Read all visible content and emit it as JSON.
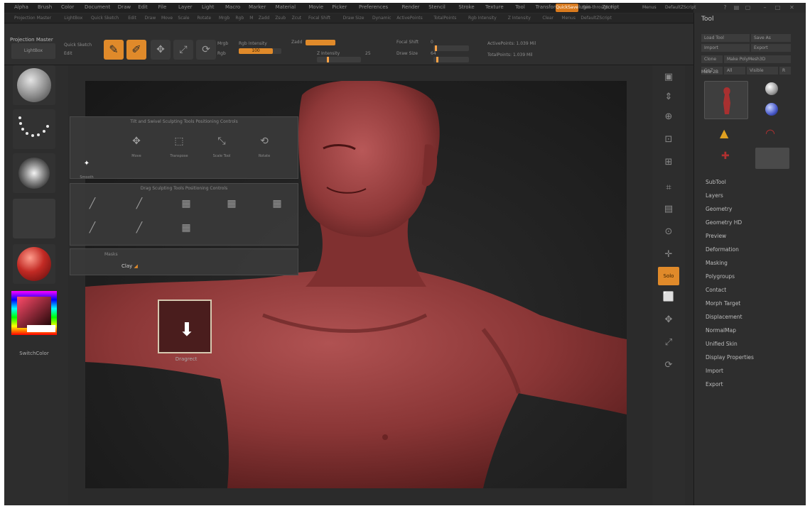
{
  "menubar": {
    "items": [
      "Alpha",
      "Brush",
      "Color",
      "Document",
      "Draw",
      "Edit",
      "File",
      "Layer",
      "Light",
      "Macro",
      "Marker",
      "Material",
      "Movie",
      "Picker",
      "Preferences",
      "Render",
      "Stencil",
      "Stroke",
      "Texture",
      "Tool",
      "Transform",
      "Zplugin",
      "Zscript"
    ],
    "submenu": [
      "Projection Master",
      "LightBox",
      "Quick Sketch",
      "Edit",
      "Draw",
      "Move",
      "Scale",
      "Rotate",
      "Mrgb",
      "Rgb",
      "M",
      "Zadd",
      "Zsub",
      "Zcut",
      "Focal Shift",
      "Draw Size",
      "Dynamic",
      "ActivePoints",
      "TotalPoints",
      "Rgb Intensity",
      "Z Intensity",
      "Clear",
      "Menus",
      "DefaultZScript"
    ],
    "quicksave": "QuickSave",
    "see_through": "See-through 0",
    "menus_label": "Menus",
    "default_zscript": "DefaultZScript"
  },
  "shelf": {
    "projection_master": "Projection Master",
    "lightbox": "LightBox",
    "quick_sketch": "Quick Sketch",
    "edit_label": "Edit",
    "draw_label": "Draw",
    "move_label": "Move",
    "scale_label": "Scale",
    "rotate_label": "Rotate",
    "mrgb": "Mrgb",
    "rgb": "Rgb",
    "m": "M",
    "rgb_intensity_label": "Rgb Intensity",
    "rgb_intensity_value": "100",
    "z_intensity_label": "Z Intensity",
    "z_intensity_value": "25",
    "zadd": "Zadd",
    "zsub": "Zsub",
    "focal_shift_label": "Focal Shift",
    "focal_shift_value": "0",
    "draw_size_label": "Draw Size",
    "draw_size_value": "64",
    "dynamic": "Dynamic",
    "active_points": "ActivePoints: 1.039 Mil",
    "total_points": "TotalPoints: 1.039 Mil"
  },
  "left_tray": {
    "color_label": "SwitchColor"
  },
  "palettes": {
    "top_title": "Tilt and Swivel Sculpting Tools Positioning Controls",
    "top_icons": [
      "Move",
      "Transpose",
      "Scale Tool",
      "Rotate",
      "Smooth"
    ],
    "mid_title": "Drag Sculpting Tools Positioning Controls",
    "bottom_label": "Masks",
    "bottom_highlight": "Clay"
  },
  "drag_item": {
    "label": "Dragrect"
  },
  "right_shelf": {
    "active_label": "Solo"
  },
  "tool_panel": {
    "title": "Tool",
    "buttons": [
      "Load Tool",
      "Save As",
      "Import",
      "Export",
      "Clone",
      "Make PolyMesh3D",
      "GoZ",
      "All",
      "Visible",
      "R"
    ],
    "active_tool": "Male 2B",
    "sections": [
      "SubTool",
      "Layers",
      "Geometry",
      "Geometry HD",
      "Preview",
      "Deformation",
      "Masking",
      "Polygroups",
      "Contact",
      "Morph Target",
      "Displacement",
      "NormalMap",
      "Unified Skin",
      "Display Properties",
      "Import",
      "Export"
    ]
  },
  "colors": {
    "accent": "#e08a2a",
    "skin": "#8a3a3a",
    "background": "#2b2b2b"
  }
}
